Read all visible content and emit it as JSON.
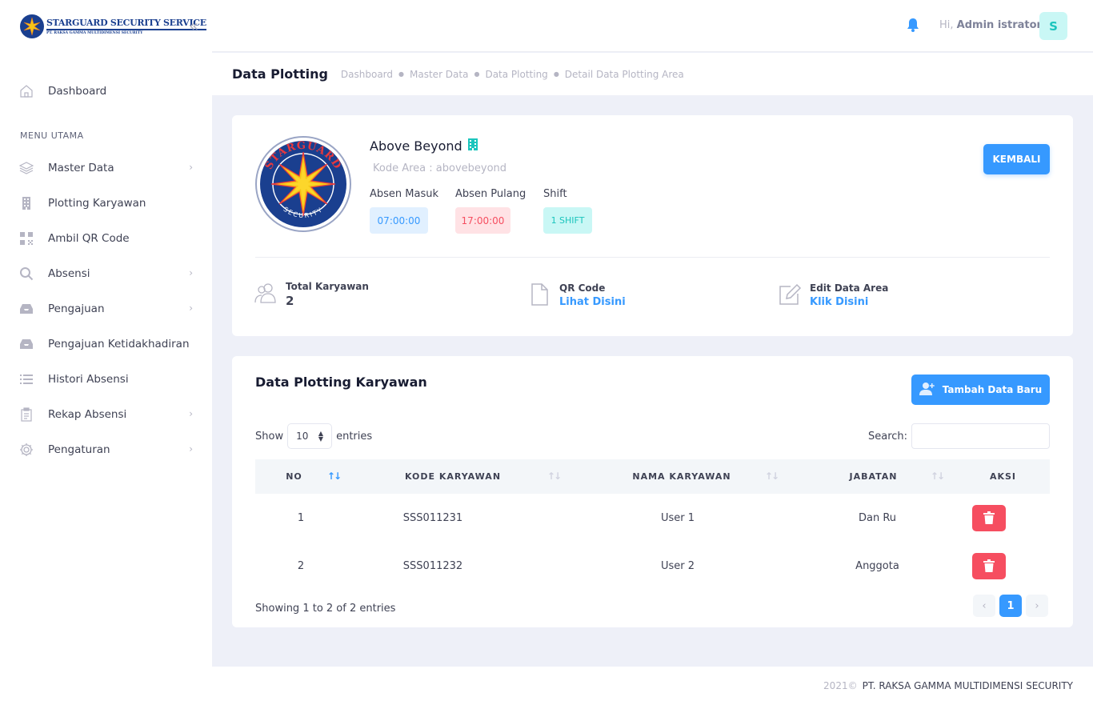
{
  "brand": {
    "title": "STARGUARD SECURITY SERVICE",
    "subtitle": "PT. RAKSA GAMMA MULTIDIMENSI SECURITY",
    "logo_color": "#1a3f8f"
  },
  "sidebar": {
    "collapse_icon": "double-chevron-left-icon",
    "dashboard": {
      "label": "Dashboard",
      "icon": "home-icon"
    },
    "section_label": "MENU UTAMA",
    "items": [
      {
        "label": "Master Data",
        "icon": "layers-icon",
        "has_submenu": true
      },
      {
        "label": "Plotting Karyawan",
        "icon": "building-icon",
        "has_submenu": false
      },
      {
        "label": "Ambil QR Code",
        "icon": "qr-code-icon",
        "has_submenu": false
      },
      {
        "label": "Absensi",
        "icon": "search-icon",
        "has_submenu": true
      },
      {
        "label": "Pengajuan",
        "icon": "inbox-icon",
        "has_submenu": true
      },
      {
        "label": "Pengajuan Ketidakhadiran",
        "icon": "inbox-icon",
        "has_submenu": false
      },
      {
        "label": "Histori Absensi",
        "icon": "list-icon",
        "has_submenu": false
      },
      {
        "label": "Rekap Absensi",
        "icon": "clipboard-icon",
        "has_submenu": true
      },
      {
        "label": "Pengaturan",
        "icon": "gear-icon",
        "has_submenu": true
      }
    ]
  },
  "header": {
    "greeting_prefix": "Hi,",
    "user_name": "Admin istrator",
    "avatar_letter": "S",
    "bell_icon": "bell-icon"
  },
  "subheader": {
    "title": "Data Plotting",
    "breadcrumbs": [
      "Dashboard",
      "Master Data",
      "Data Plotting",
      "Detail Data Plotting Area"
    ]
  },
  "area": {
    "name": "Above Beyond",
    "code_text": "Kode Area : abovebeyond",
    "logo_text_top": "STARGUARD",
    "logo_text_bottom": "SECURITY",
    "absen_masuk_label": "Absen Masuk",
    "absen_masuk_value": "07:00:00",
    "absen_pulang_label": "Absen Pulang",
    "absen_pulang_value": "17:00:00",
    "shift_label": "Shift",
    "shift_value": "1 SHIFT",
    "back_button": "KEMBALI"
  },
  "stats": {
    "total_karyawan_label": "Total Karyawan",
    "total_karyawan_value": "2",
    "qr_label": "QR Code",
    "qr_link": "Lihat Disini",
    "edit_label": "Edit Data Area",
    "edit_link": "Klik Disini"
  },
  "table_section": {
    "title": "Data Plotting Karyawan",
    "add_button": "Tambah Data Baru",
    "show_label": "Show",
    "entries_value": "10",
    "entries_label": "entries",
    "search_label": "Search:",
    "search_value": "",
    "columns": [
      "NO",
      "KODE KARYAWAN",
      "NAMA KARYAWAN",
      "JABATAN",
      "AKSI"
    ],
    "rows": [
      {
        "no": "1",
        "kode": "SSS011231",
        "nama": "User 1",
        "jabatan": "Dan Ru"
      },
      {
        "no": "2",
        "kode": "SSS011232",
        "nama": "User 2",
        "jabatan": "Anggota"
      }
    ],
    "info": "Showing 1 to 2 of 2 entries",
    "pagination": {
      "prev": "‹",
      "current": "1",
      "next": "›"
    }
  },
  "footer": {
    "year": "2021©",
    "company": "PT. RAKSA GAMMA MULTIDIMENSI SECURITY"
  },
  "colors": {
    "primary": "#3699ff",
    "danger": "#f64e60",
    "teal": "#1bc5bd"
  }
}
